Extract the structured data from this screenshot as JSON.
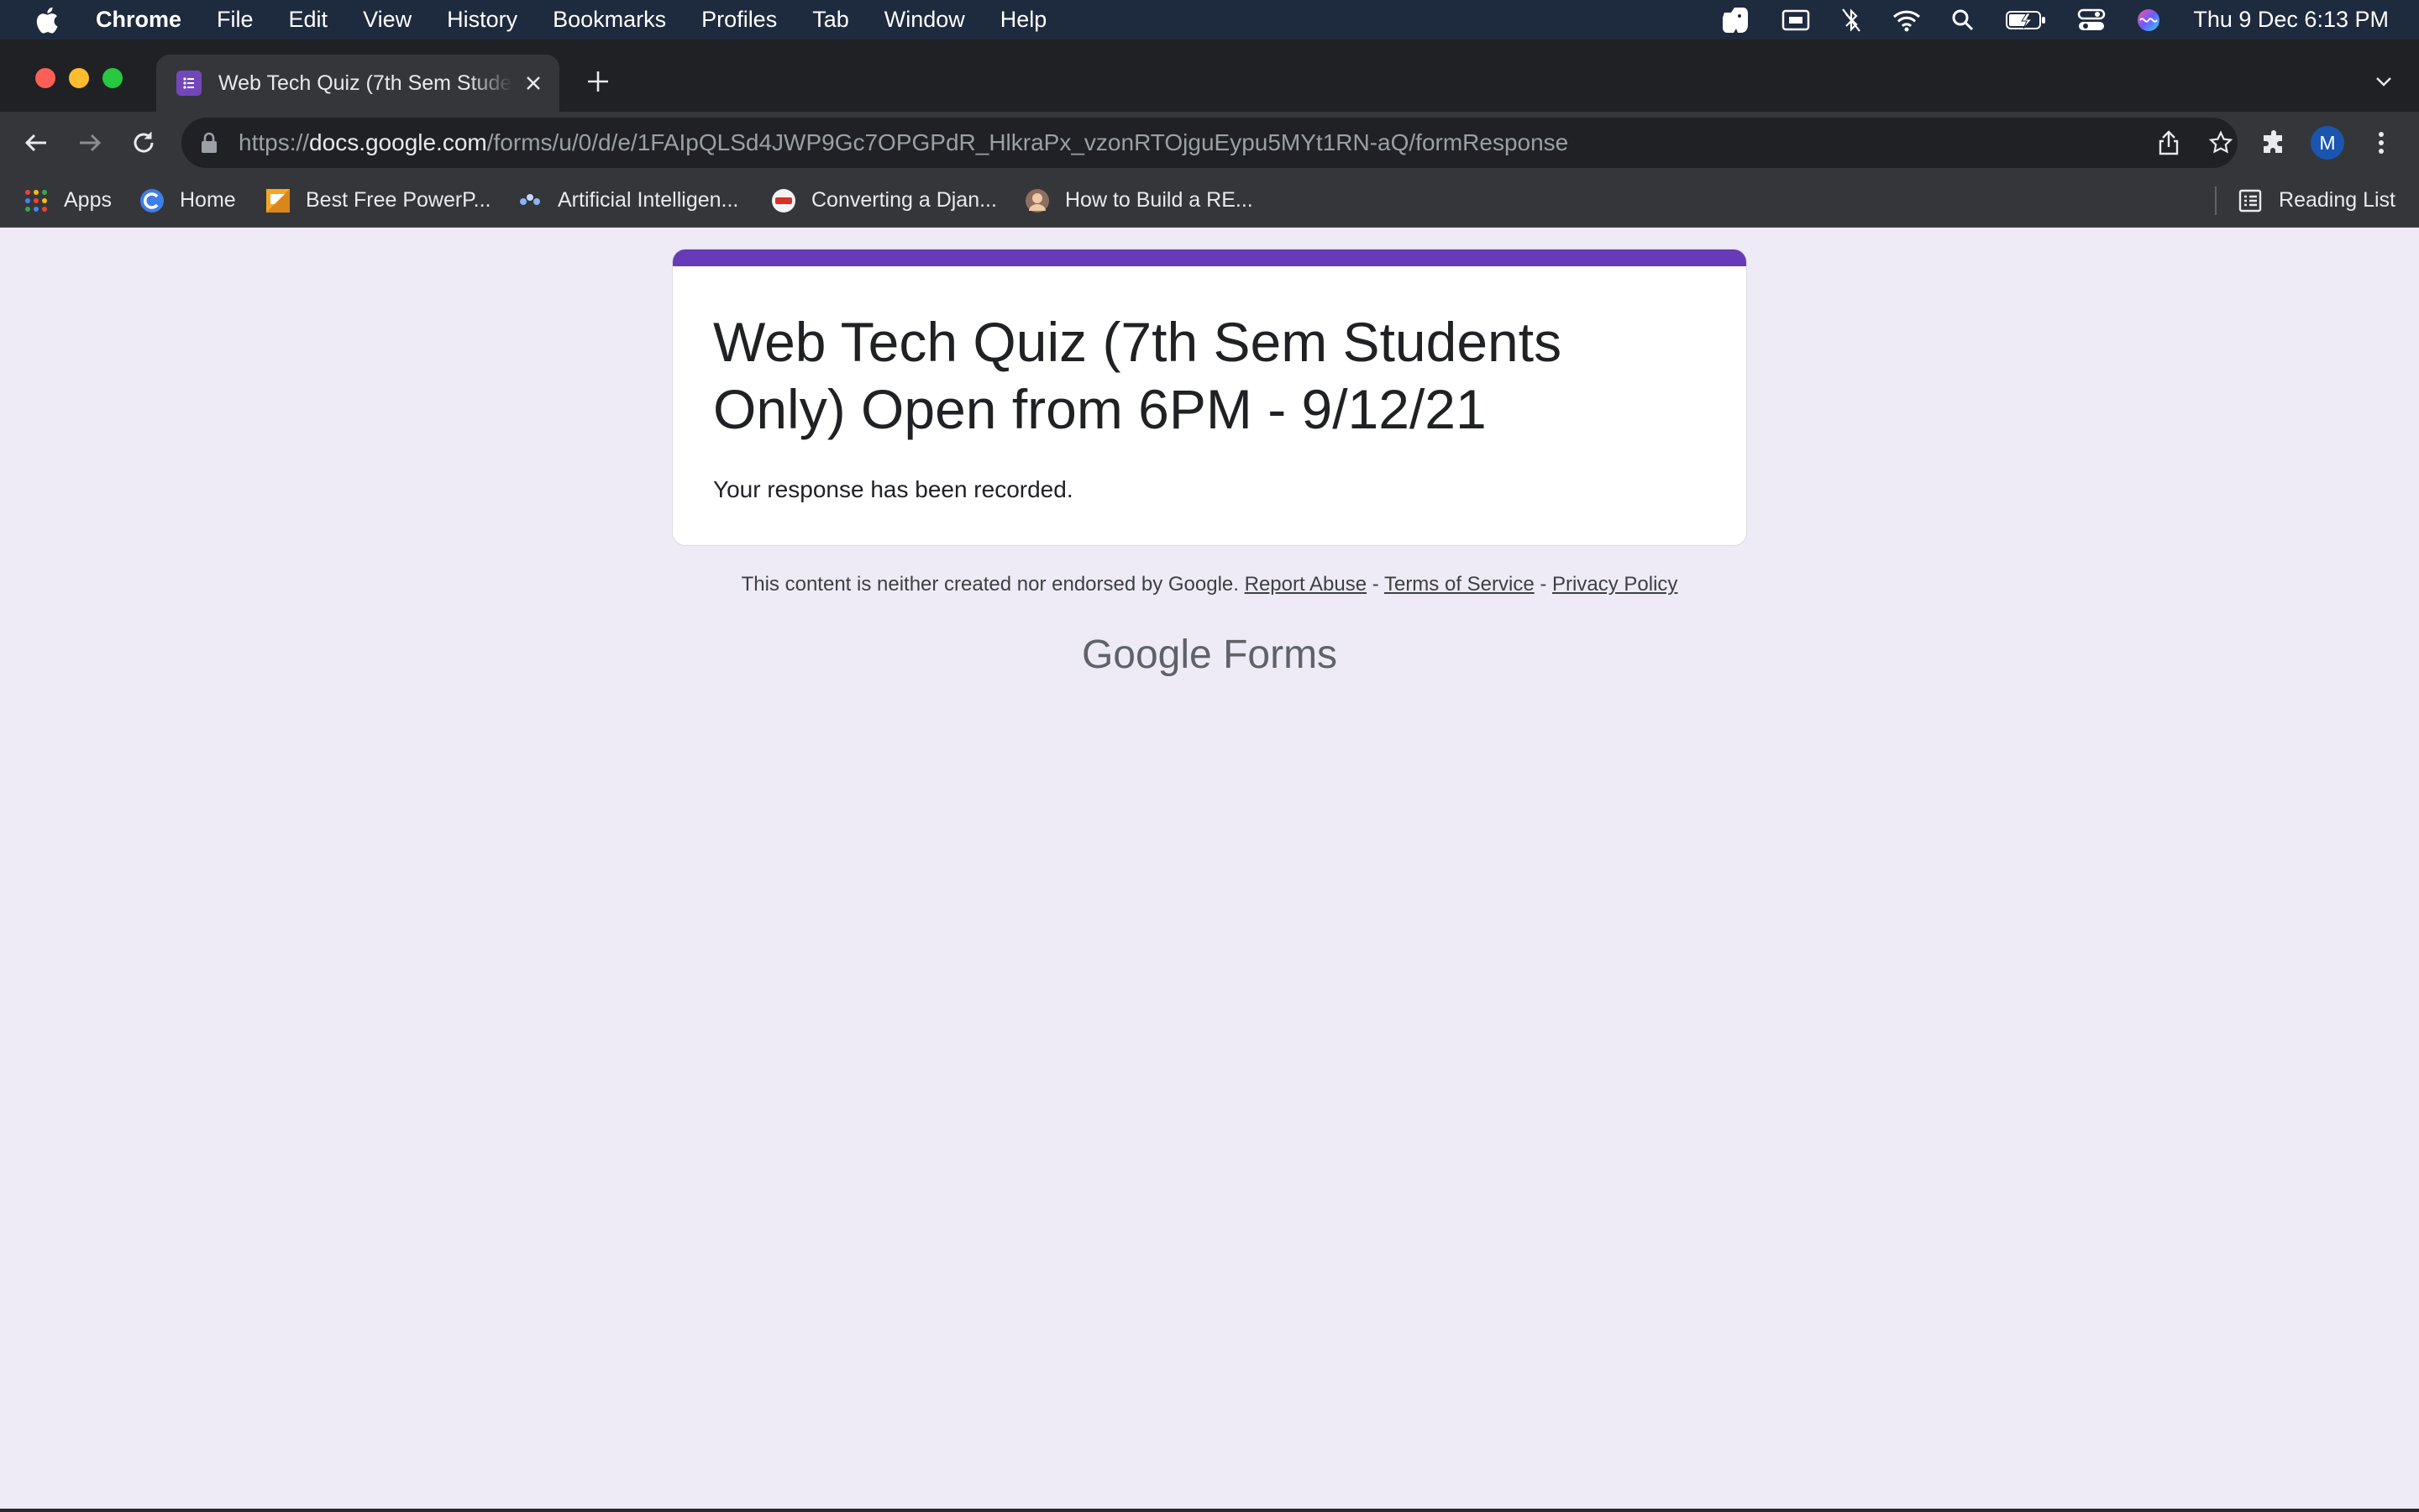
{
  "menubar": {
    "apple_icon": "apple-logo-icon",
    "app_name": "Chrome",
    "items": [
      "File",
      "Edit",
      "View",
      "History",
      "Bookmarks",
      "Profiles",
      "Tab",
      "Window",
      "Help"
    ],
    "status_icons": [
      "evernote-icon",
      "screen-display-icon",
      "bluetooth-off-icon",
      "wifi-icon",
      "spotlight-search-icon",
      "battery-charging-icon",
      "control-center-icon",
      "siri-icon"
    ],
    "clock": "Thu 9 Dec  6:13 PM"
  },
  "browser": {
    "tab": {
      "title": "Web Tech Quiz (7th Sem Students Only) Open from 6PM - 9/12/21",
      "favicon": "google-forms-icon"
    },
    "address": {
      "scheme": "https://",
      "host": "docs.google.com",
      "path": "/forms/u/0/d/e/1FAIpQLSd4JWP9Gc7OPGPdR_HlkraPx_vzonRTOjguEypu5MYt1RN-aQ/formResponse"
    },
    "profile_initial": "M",
    "bookmarks": [
      {
        "label": "Apps",
        "icon": "apps-grid-icon"
      },
      {
        "label": "Home",
        "icon": "c-logo-icon"
      },
      {
        "label": "Best Free PowerP...",
        "icon": "slides-icon"
      },
      {
        "label": "Artificial Intelligen...",
        "icon": "ai-icon"
      },
      {
        "label": "Converting a Djan...",
        "icon": "site-logo-icon"
      },
      {
        "label": "How to Build a RE...",
        "icon": "avatar-icon"
      }
    ],
    "reading_list": "Reading List"
  },
  "form": {
    "title": "Web Tech Quiz (7th Sem Students Only) Open from 6PM - 9/12/21",
    "confirmation": "Your response has been recorded.",
    "accent_color": "#673ab7"
  },
  "footer": {
    "disclaimer": "This content is neither created nor endorsed by Google.",
    "report_abuse": "Report Abuse",
    "terms": "Terms of Service",
    "privacy": "Privacy Policy",
    "separator": "-",
    "brand_google": "Google",
    "brand_forms": "Forms"
  },
  "colors": {
    "page_background": "#efebf6",
    "menubar": "#1e2a3e",
    "chrome_dark": "#35363a"
  }
}
